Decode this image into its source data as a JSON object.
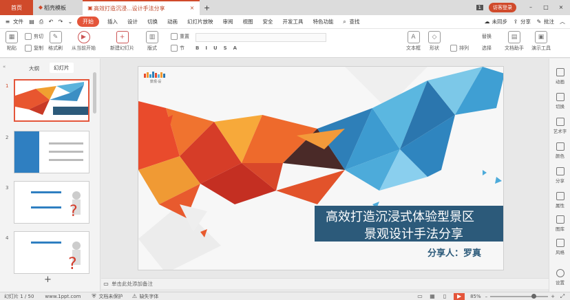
{
  "tabs": {
    "home": "首页",
    "shell": "稻壳模板",
    "doc": "高效打造沉浸...设计手法分享",
    "new": "+"
  },
  "titlebar": {
    "page_badge": "1",
    "login": "访客登录"
  },
  "menu": {
    "file": "文件",
    "items": [
      "开始",
      "插入",
      "设计",
      "切换",
      "动画",
      "幻灯片放映",
      "审阅",
      "视图",
      "安全",
      "开发工具",
      "特色功能"
    ],
    "search": "查找",
    "sync": "未同步",
    "share": "分享",
    "annotate": "批注"
  },
  "ribbon": {
    "cut": "剪切",
    "copy": "复制",
    "paste": "粘贴",
    "format_painter": "格式刷",
    "from_start": "从当前开始",
    "new_slide": "新建幻灯片",
    "layout": "版式",
    "section": "节",
    "reset": "重置",
    "textbox": "文本框",
    "shape": "形状",
    "arrange": "排列",
    "doc_assistant": "文档助手",
    "presenter_tools": "演示工具",
    "select": "选择",
    "replace": "替换"
  },
  "left_panel": {
    "tab_outline": "大纲",
    "tab_slides": "幻灯片",
    "thumb_numbers": [
      "1",
      "2",
      "3",
      "4"
    ],
    "add": "+"
  },
  "slide": {
    "title_line1": "高效打造沉浸式体验型景区",
    "title_line2": "景观设计手法分享",
    "presenter": "分享人：罗真",
    "logo_text": "景观·设"
  },
  "notes_placeholder": "单击此处添加备注",
  "right_bar": [
    "动画",
    "切换",
    "艺术字",
    "颜色",
    "分享",
    "属性",
    "图库",
    "风格",
    "设置"
  ],
  "status": {
    "page": "幻灯片 1 / 50",
    "site": "www.1ppt.com",
    "doc_unprotected": "文档未保护",
    "missing_font": "缺失字体",
    "zoom": "85%",
    "zoom_minus": "–",
    "zoom_plus": "+"
  },
  "colors": {
    "accent": "#d04a2b",
    "slide_banner": "#2c5a7a",
    "presenter_text": "#2c5a7a"
  }
}
